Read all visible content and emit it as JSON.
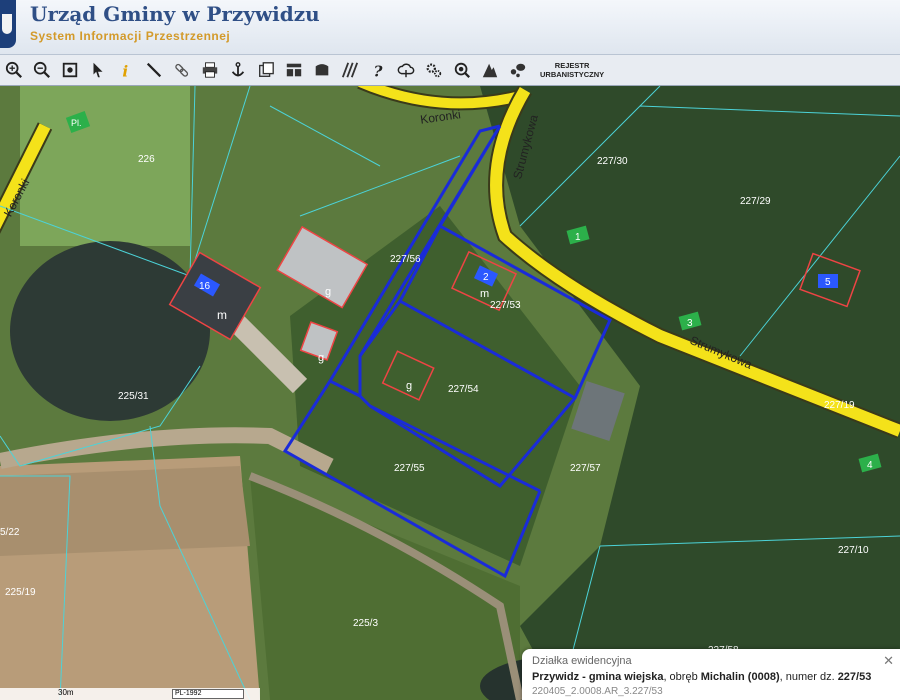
{
  "header": {
    "title": "Urząd Gminy w Przywidzu",
    "subtitle": "System Informacji Przestrzennej"
  },
  "toolbar": {
    "tools": [
      "zoom-in-icon",
      "zoom-out-icon",
      "zoom-extent-icon",
      "pointer-icon",
      "info-icon",
      "measure-icon",
      "link-icon",
      "print-icon",
      "anchor-icon",
      "export-icon",
      "layout-icon",
      "shape-icon",
      "hatch-icon",
      "help-icon",
      "cloud-icon",
      "settings-icon",
      "magnifier-icon",
      "terrain-icon",
      "chat-icon"
    ],
    "register_label_line1": "REJESTR",
    "register_label_line2": "URBANISTYCZNY"
  },
  "map": {
    "parcels": [
      "226",
      "227/30",
      "227/29",
      "227/53",
      "227/54",
      "227/55",
      "227/57",
      "227/10",
      "225/31",
      "225/19",
      "225/3",
      "227/58",
      "227/56",
      "5/22",
      "227/19"
    ],
    "roads": [
      "Koronki",
      "Strumykowa"
    ],
    "building_letters": [
      "m",
      "g",
      "m",
      "g",
      "g"
    ],
    "address_numbers": [
      "1",
      "3",
      "4",
      "5",
      "16",
      "2",
      "Pl."
    ]
  },
  "info_panel": {
    "heading": "Działka ewidencyjna",
    "municipality": "Przywidz - gmina wiejska",
    "precinct_prefix": ", obręb ",
    "precinct": "Michalin (0008)",
    "number_prefix": ", numer dz. ",
    "number": "227/53",
    "identifier": "220405_2.0008.AR_3.227/53",
    "close": "✕"
  },
  "scale": {
    "text": "30m",
    "crs": "PL-1992"
  }
}
